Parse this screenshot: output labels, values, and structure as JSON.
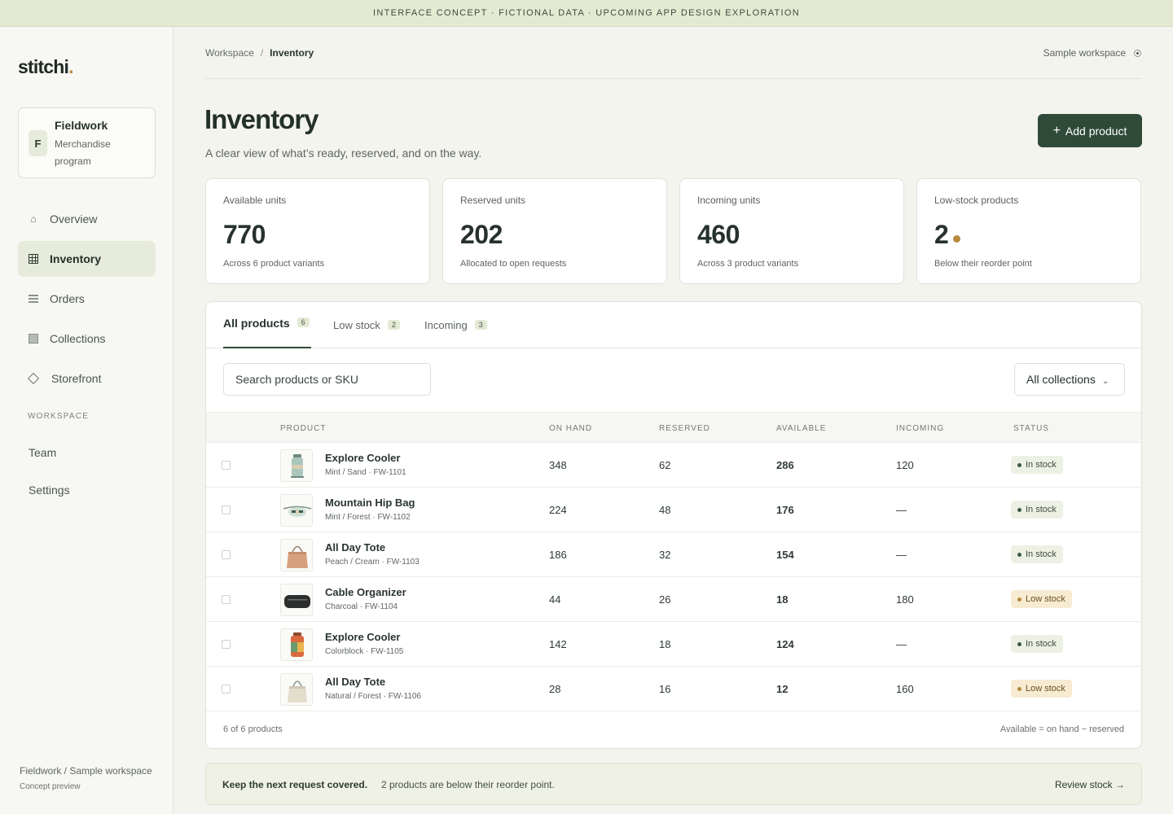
{
  "banner": "INTERFACE CONCEPT · FICTIONAL DATA · UPCOMING APP DESIGN EXPLORATION",
  "logo": {
    "text": "stitchi",
    "dot": "."
  },
  "org": {
    "initial": "F",
    "name": "Fieldwork",
    "subtitle": "Merchandise program"
  },
  "nav": [
    {
      "label": "Overview",
      "icon": "home-icon"
    },
    {
      "label": "Inventory",
      "icon": "grid-icon",
      "active": true
    },
    {
      "label": "Orders",
      "icon": "list-icon"
    },
    {
      "label": "Collections",
      "icon": "box-icon"
    },
    {
      "label": "Storefront",
      "icon": "diamond-icon"
    }
  ],
  "nav_section": "WORKSPACE",
  "nav_secondary": [
    "Team",
    "Settings"
  ],
  "sidebar_footer": {
    "title": "Fieldwork / Sample workspace",
    "note": "Concept preview"
  },
  "breadcrumb": {
    "root": "Workspace",
    "sep": "/",
    "current": "Inventory"
  },
  "workspace_switch": "Sample workspace",
  "page": {
    "title": "Inventory",
    "subtitle": "A clear view of what’s ready, reserved, and on the way.",
    "add_button": "Add product",
    "add_icon": "+"
  },
  "stats": [
    {
      "label": "Available units",
      "value": "770",
      "note": "Across 6 product variants"
    },
    {
      "label": "Reserved units",
      "value": "202",
      "note": "Allocated to open requests"
    },
    {
      "label": "Incoming units",
      "value": "460",
      "note": "Across 3 product variants"
    },
    {
      "label": "Low-stock products",
      "value": "2",
      "note": "Below their reorder point"
    }
  ],
  "tabs": [
    {
      "label": "All products",
      "count": "6",
      "active": true
    },
    {
      "label": "Low stock",
      "count": "2"
    },
    {
      "label": "Incoming",
      "count": "3"
    }
  ],
  "search": {
    "placeholder": "Search products or SKU"
  },
  "filter": {
    "selected": "All collections"
  },
  "table": {
    "columns": [
      "PRODUCT",
      "ON HAND",
      "RESERVED",
      "AVAILABLE",
      "INCOMING",
      "STATUS"
    ],
    "rows": [
      {
        "name": "Explore Cooler",
        "meta": "Mint / Sand · FW-1101",
        "on_hand": "348",
        "reserved": "62",
        "available": "286",
        "incoming": "120",
        "status": "In stock",
        "status_kind": "in"
      },
      {
        "name": "Mountain Hip Bag",
        "meta": "Mint / Forest · FW-1102",
        "on_hand": "224",
        "reserved": "48",
        "available": "176",
        "incoming": "—",
        "status": "In stock",
        "status_kind": "in"
      },
      {
        "name": "All Day Tote",
        "meta": "Peach / Cream · FW-1103",
        "on_hand": "186",
        "reserved": "32",
        "available": "154",
        "incoming": "—",
        "status": "In stock",
        "status_kind": "in"
      },
      {
        "name": "Cable Organizer",
        "meta": "Charcoal · FW-1104",
        "on_hand": "44",
        "reserved": "26",
        "available": "18",
        "incoming": "180",
        "status": "Low stock",
        "status_kind": "low"
      },
      {
        "name": "Explore Cooler",
        "meta": "Colorblock · FW-1105",
        "on_hand": "142",
        "reserved": "18",
        "available": "124",
        "incoming": "—",
        "status": "In stock",
        "status_kind": "in"
      },
      {
        "name": "All Day Tote",
        "meta": "Natural / Forest · FW-1106",
        "on_hand": "28",
        "reserved": "16",
        "available": "12",
        "incoming": "160",
        "status": "Low stock",
        "status_kind": "low"
      }
    ],
    "footer_count": "6 of 6 products",
    "footer_note": "Available = on hand − reserved"
  },
  "callout": {
    "strong": "Keep the next request covered.",
    "text": "2 products are below their reorder point.",
    "link": "Review stock →"
  },
  "colors": {
    "accent": "#2f4b38",
    "low_stock": "#b58a3c",
    "banner": "#e4e9d2"
  }
}
